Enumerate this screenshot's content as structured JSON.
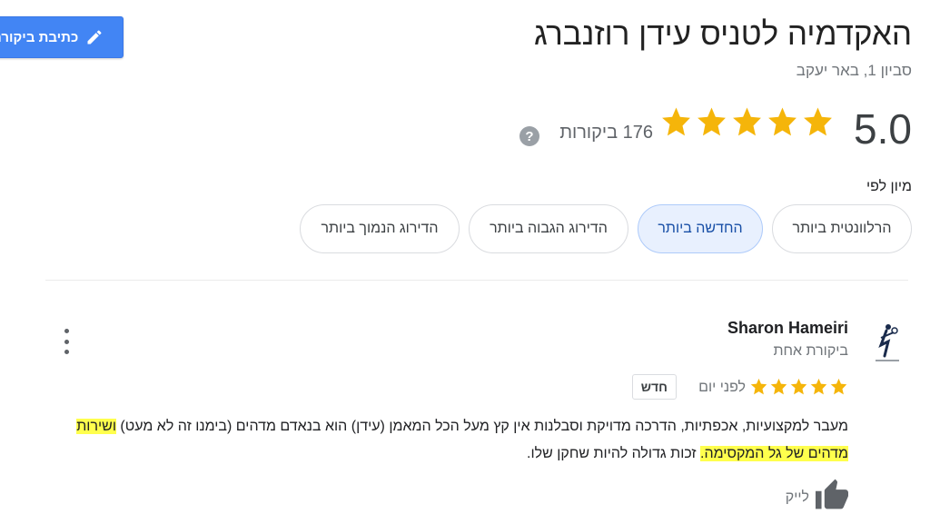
{
  "header": {
    "write_review_label": "כתיבת ביקורת",
    "title": "האקדמיה לטניס עידן רוזנברג",
    "address": "סביון 1, באר יעקב"
  },
  "summary": {
    "rating": "5.0",
    "stars": 5,
    "review_count": "176 ביקורות",
    "help_icon": "question-circle-icon",
    "star_color": "#f5b50a"
  },
  "sort": {
    "label": "מיון לפי",
    "options": [
      "הרלוונטית ביותר",
      "החדשה ביותר",
      "הדירוג הגבוה ביותר",
      "הדירוג הנמוך ביותר"
    ],
    "selected": "החדשה ביותר"
  },
  "review": {
    "author": "Sharon Hameiri",
    "author_meta": "ביקורת אחת",
    "stars": 5,
    "time": "לפני יום",
    "badge": "חדש",
    "text_part1": "מעבר למקצועיות, אכפתיות, הדרכה מדויקת וסבלנות אין קץ מעל הכל המאמן (עידן) הוא בנאדם מדהים (בימנו זה לא מעט) ",
    "text_highlight": "ושירות מדהים של גל המקסימה.",
    "text_part2": " זכות גדולה להיות שחקן שלו.",
    "like_label": "לייק",
    "highlight_color": "#ffff4d"
  }
}
